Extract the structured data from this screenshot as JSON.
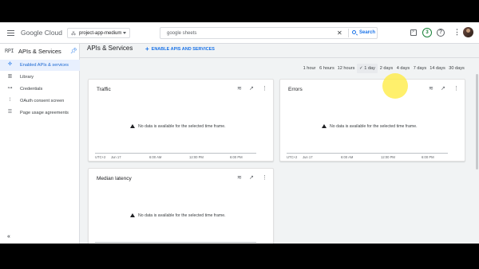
{
  "header": {
    "brand_google": "Google",
    "brand_cloud": "Cloud",
    "project_name": "project-app-medium",
    "search_value": "google sheets",
    "search_button": "Search",
    "notification_count": "3",
    "help_glyph": "?"
  },
  "sidebar": {
    "logo": "RPI",
    "title": "APIs & Services",
    "items": [
      {
        "label": "Enabled APIs & services",
        "icon": "enabled-apis-icon",
        "active": true
      },
      {
        "label": "Library",
        "icon": "library-icon",
        "active": false
      },
      {
        "label": "Credentials",
        "icon": "key-icon",
        "active": false
      },
      {
        "label": "OAuth consent screen",
        "icon": "consent-icon",
        "active": false
      },
      {
        "label": "Page usage agreements",
        "icon": "agreements-icon",
        "active": false
      }
    ],
    "collapse_glyph": "«"
  },
  "main": {
    "title": "APIs & Services",
    "enable_button": "ENABLE APIS AND SERVICES",
    "time_ranges": [
      "1 hour",
      "6 hours",
      "12 hours",
      "1 day",
      "2 days",
      "4 days",
      "7 days",
      "14 days",
      "30 days"
    ],
    "selected_range": "1 day",
    "no_data_text": "No data is available for the selected time frame.",
    "cards": [
      {
        "title": "Traffic",
        "ticks": [
          "UTC+2",
          "Jun 17",
          "6:00 AM",
          "12:00 PM",
          "6:00 PM"
        ]
      },
      {
        "title": "Errors",
        "ticks": [
          "UTC+2",
          "Jun 17",
          "6:00 AM",
          "12:00 PM",
          "6:00 PM"
        ]
      },
      {
        "title": "Median latency",
        "ticks": []
      }
    ]
  },
  "colors": {
    "accent": "#1a73e8",
    "active_bg": "#e8f0fe",
    "badge": "#188038"
  }
}
